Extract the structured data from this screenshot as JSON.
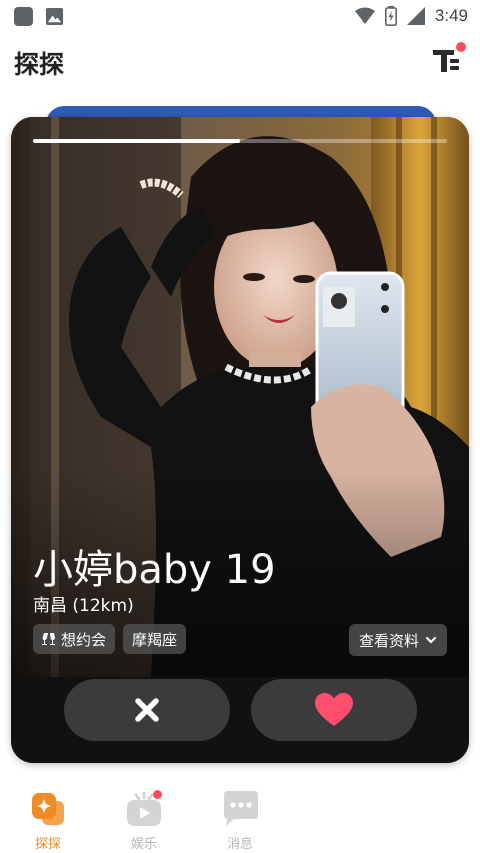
{
  "status_bar": {
    "time": "3:49"
  },
  "header": {
    "title": "探探"
  },
  "card": {
    "photo_progress": 0.5,
    "name_age": "小婷baby 19",
    "location": "南昌 (12km)",
    "tags": [
      {
        "icon": "date-icon",
        "label": "想约会"
      },
      {
        "icon": "",
        "label": "摩羯座"
      }
    ],
    "view_profile_label": "查看资料"
  },
  "bottom_nav": {
    "items": [
      {
        "label": "探探",
        "active": true
      },
      {
        "label": "娱乐",
        "active": false
      },
      {
        "label": "消息",
        "active": false
      }
    ]
  },
  "colors": {
    "accent": "#f08a24",
    "like": "#ff4d6d",
    "notification": "#ff4d5a",
    "back_card": "#2f5bb7"
  }
}
